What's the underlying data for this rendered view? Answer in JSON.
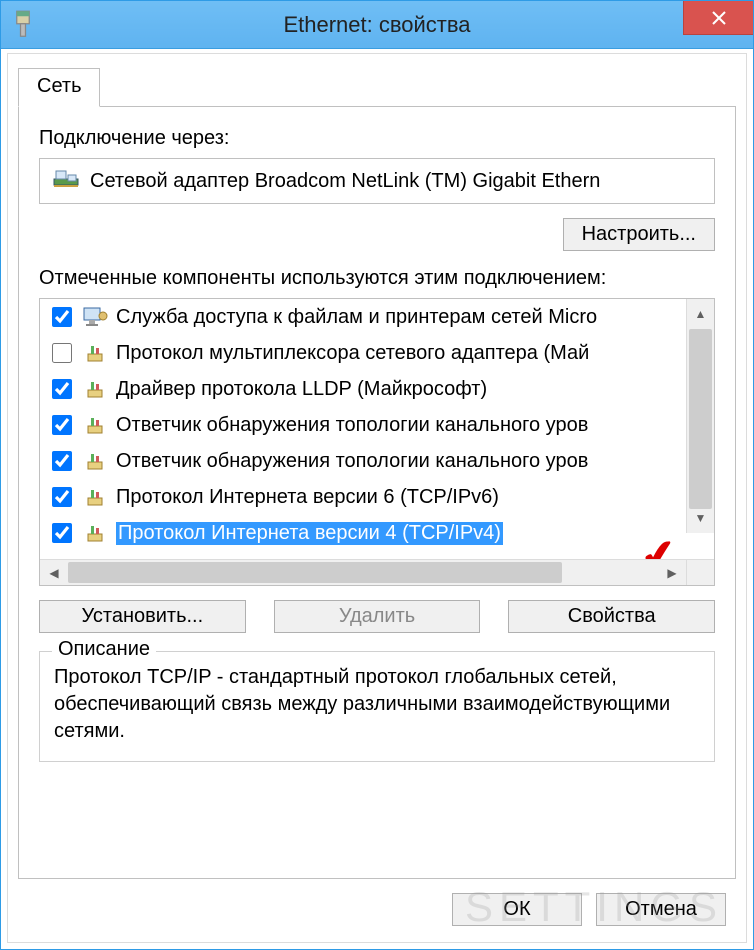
{
  "window": {
    "title": "Ethernet: свойства"
  },
  "tab": {
    "network": "Сеть"
  },
  "connect_using": {
    "label": "Подключение через:",
    "adapter": "Сетевой адаптер Broadcom NetLink (TM) Gigabit Ethern"
  },
  "buttons": {
    "configure": "Настроить...",
    "install": "Установить...",
    "uninstall": "Удалить",
    "properties": "Свойства",
    "ok": "ОК",
    "cancel": "Отмена"
  },
  "components": {
    "label": "Отмеченные компоненты используются этим подключением:",
    "items": [
      {
        "checked": true,
        "icon": "computer",
        "label": "Служба доступа к файлам и принтерам сетей Micro"
      },
      {
        "checked": false,
        "icon": "protocol",
        "label": "Протокол мультиплексора сетевого адаптера (Май"
      },
      {
        "checked": true,
        "icon": "protocol",
        "label": "Драйвер протокола LLDP (Майкрософт)"
      },
      {
        "checked": true,
        "icon": "protocol",
        "label": "Ответчик обнаружения топологии канального уров"
      },
      {
        "checked": true,
        "icon": "protocol",
        "label": "Ответчик обнаружения топологии канального уров"
      },
      {
        "checked": true,
        "icon": "protocol",
        "label": "Протокол Интернета версии 6 (TCP/IPv6)"
      },
      {
        "checked": true,
        "icon": "protocol",
        "label": "Протокол Интернета версии 4 (TCP/IPv4)",
        "selected": true
      }
    ]
  },
  "description": {
    "legend": "Описание",
    "text": "Протокол TCP/IP - стандартный протокол глобальных сетей, обеспечивающий связь между различными взаимодействующими сетями."
  },
  "watermark": "SETTINGS"
}
